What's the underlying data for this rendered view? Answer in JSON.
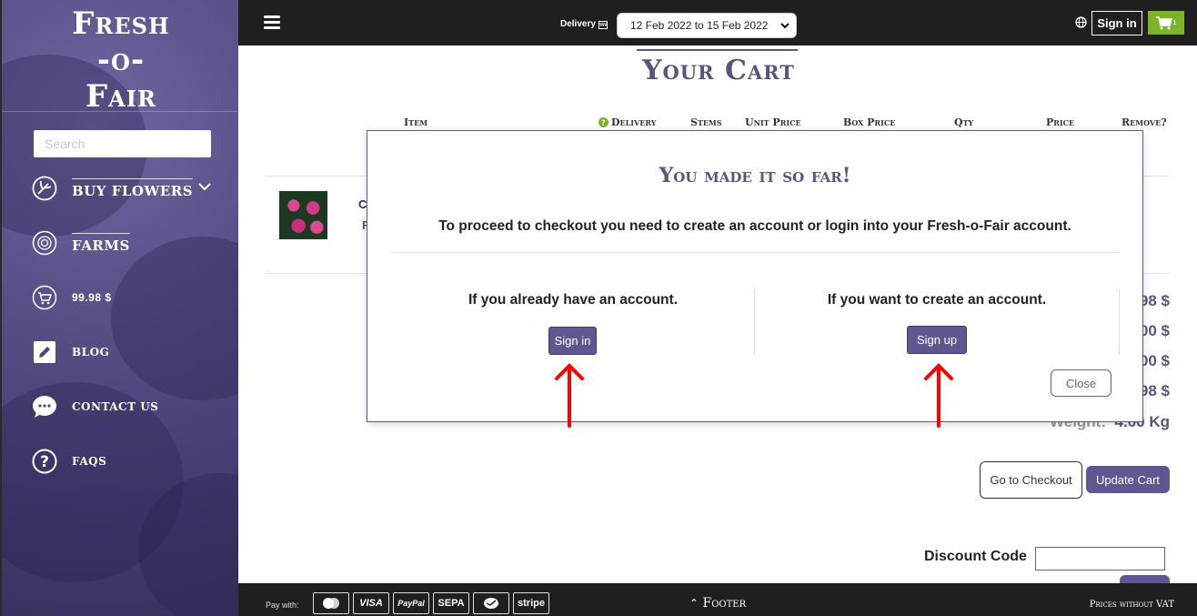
{
  "sidebar": {
    "logo_lines": [
      "Fresh",
      "-o-",
      "Fair"
    ],
    "search_placeholder": "Search",
    "items": [
      {
        "label": "BUY FLOWERS",
        "icon": "flower-stem-icon"
      },
      {
        "label": "FARMS",
        "icon": "rose-icon"
      },
      {
        "label": "99.98 $",
        "icon": "cart-icon"
      },
      {
        "label": "BLOG",
        "icon": "pencil-icon"
      },
      {
        "label": "CONTACT US",
        "icon": "chat-icon"
      },
      {
        "label": "FAQS",
        "icon": "question-icon"
      }
    ]
  },
  "topbar": {
    "delivery_label": "Delivery",
    "date_range": "12 Feb 2022 to 15 Feb 2022",
    "signin_label": "Sign in",
    "cart_count": "1"
  },
  "cart": {
    "title": "Your Cart",
    "columns": [
      "Item",
      "Delivery",
      "Stems",
      "Unit Price",
      "Box Price",
      "Qty",
      "Price",
      "Remove?"
    ],
    "row_text": [
      "C",
      "F"
    ],
    "summary_values": [
      "98 $",
      "00 $",
      "00 $",
      "98 $"
    ],
    "weight_label": "Weight:",
    "weight_value": "4.00 Kg",
    "checkout_label": "Go to Checkout",
    "update_label": "Update Cart",
    "discount_label": "Discount Code"
  },
  "modal": {
    "title": "You made it so far!",
    "message": "To proceed to checkout you need to create an account or login into your Fresh-o-Fair account.",
    "left_text": "If you already have an account.",
    "left_button": "Sign in",
    "right_text": "If you want to create an account.",
    "right_button": "Sign up",
    "close_label": "Close"
  },
  "footer": {
    "paywith_label": "Pay with:",
    "payment_methods": [
      "mastercard",
      "VISA",
      "PayPal",
      "SEPA",
      "wechat",
      "stripe"
    ],
    "center_label": "Footer",
    "right_label": "Prices without VAT"
  },
  "colors": {
    "brand_purple": "#5f5890",
    "cart_green": "#7cb32a",
    "annotation_red": "#ff0000",
    "topbar_bg": "#1f1f1f"
  }
}
